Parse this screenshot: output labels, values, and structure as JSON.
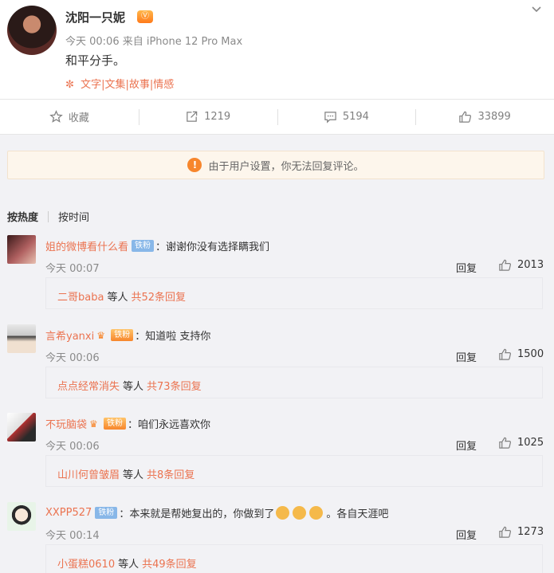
{
  "post": {
    "author": "沈阳一只妮",
    "meta": "今天 00:06 来自 iPhone 12 Pro Max",
    "text": "和平分手。",
    "tags": "文字|文集|故事|情感",
    "vip_badge": "Ⓥ"
  },
  "actions": {
    "favorite": "收藏",
    "repost": "1219",
    "comment": "5194",
    "like": "33899"
  },
  "notice": "由于用户设置，你无法回复评论。",
  "sort": {
    "hot": "按热度",
    "time": "按时间"
  },
  "comments": [
    {
      "user": "姐的微博看什么看",
      "badge": "铁粉",
      "text": "：谢谢你没有选择瞒我们",
      "time": "今天 00:07",
      "reply": "回复",
      "likes": "2013",
      "reply_user": "二哥baba",
      "reply_mid": "等人",
      "reply_count": "共52条回复"
    },
    {
      "user": "言希yanxi",
      "badge": "铁粉",
      "text": "：知道啦  支持你",
      "time": "今天 00:06",
      "reply": "回复",
      "likes": "1500",
      "reply_user": "点点经常消失",
      "reply_mid": "等人",
      "reply_count": "共73条回复"
    },
    {
      "user": "不玩脑袋",
      "badge": "铁粉",
      "text": "：咱们永远喜欢你",
      "time": "今天 00:06",
      "reply": "回复",
      "likes": "1025",
      "reply_user": "山川何曾皱眉",
      "reply_mid": "等人",
      "reply_count": "共8条回复"
    },
    {
      "user": "XXPP527",
      "badge": "铁粉",
      "text": "：本来就是帮她复出的，你做到了",
      "text_after": "。各自天涯吧",
      "time": "今天 00:14",
      "reply": "回复",
      "likes": "1273",
      "reply_user": "小蛋糕0610",
      "reply_mid": "等人",
      "reply_count": "共49条回复"
    }
  ],
  "icons": {
    "more": "chevron-down-icon",
    "favorite": "star-icon",
    "repost": "share-icon",
    "comment": "comment-icon",
    "like": "thumbs-up-icon",
    "notice": "warning-icon"
  },
  "colors": {
    "accent": "#eb7350",
    "notice_bg": "#fdf6ec",
    "fan_badge": "#88b7e8"
  }
}
